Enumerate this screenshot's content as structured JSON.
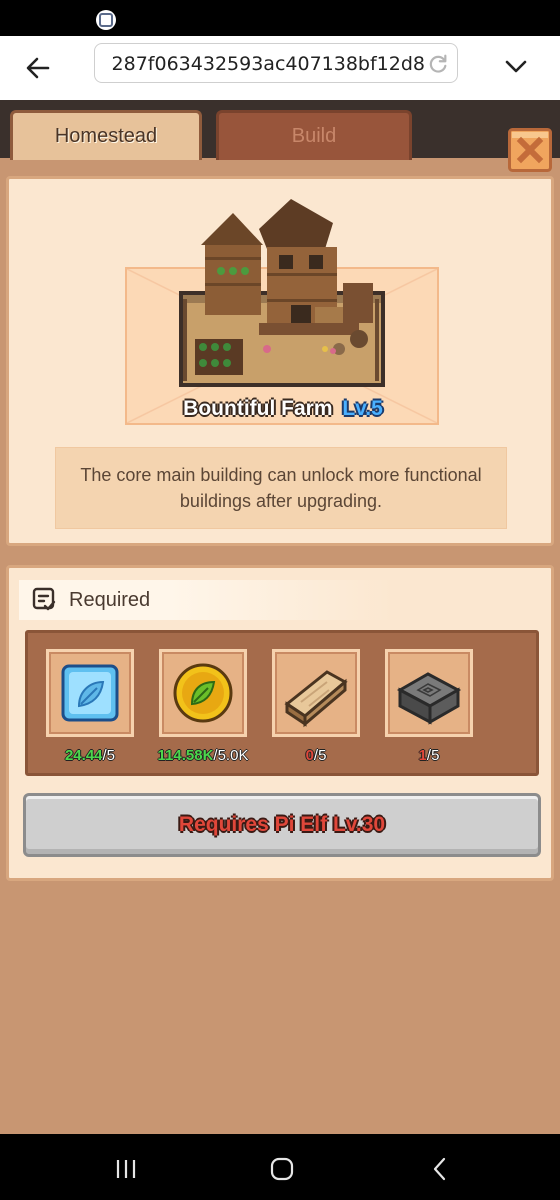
{
  "browser": {
    "url": "287f063432593ac407138bf12d8"
  },
  "tabs": {
    "homestead": "Homestead",
    "build": "Build"
  },
  "building": {
    "name": "Bountiful Farm",
    "level": "Lv.5",
    "description": "The core main building can unlock more functional buildings after upgrading."
  },
  "requirements": {
    "label": "Required",
    "resources": [
      {
        "icon": "leaf-crystal-icon",
        "have": "24.44",
        "need": "/5",
        "have_color": "#4cd64c"
      },
      {
        "icon": "gold-leaf-coin-icon",
        "have": "114.58K",
        "need": "/5.0K",
        "have_color": "#4cd64c"
      },
      {
        "icon": "wood-plank-icon",
        "have": "0",
        "need": "/5",
        "have_color": "#e0473a"
      },
      {
        "icon": "stone-block-icon",
        "have": "1",
        "need": "/5",
        "have_color": "#e0473a"
      }
    ],
    "action_label": "Requires Pi Elf Lv.30"
  },
  "colors": {
    "panel_bg": "#fbe7d0",
    "game_bg": "#c89672",
    "requirement_text": "#e0473a",
    "level_text": "#4ab0ff"
  }
}
